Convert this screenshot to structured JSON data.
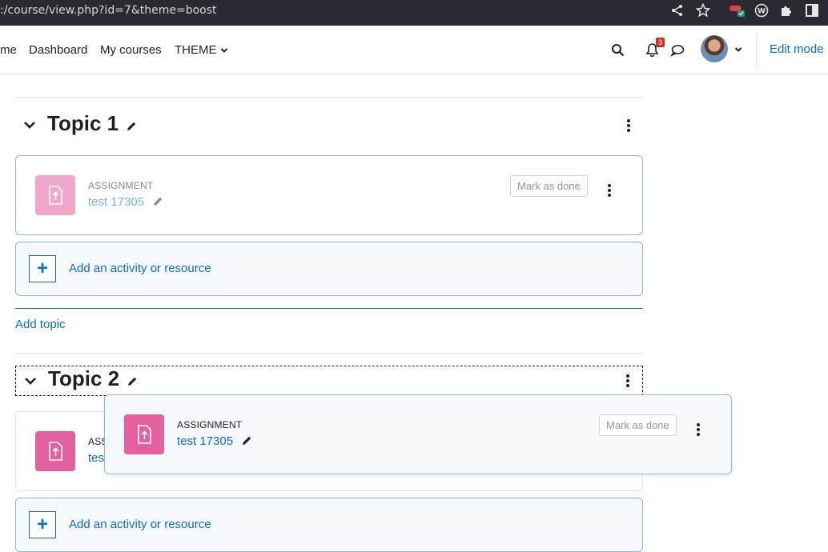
{
  "browser": {
    "url": ":/course/view.php?id=7&theme=boost",
    "icons": [
      "share-icon",
      "star-icon",
      "extension-red-icon",
      "wordpress-icon",
      "puzzle-icon",
      "sidebar-icon"
    ]
  },
  "navbar": {
    "home_partial": "me",
    "dashboard": "Dashboard",
    "my_courses": "My courses",
    "theme": "THEME",
    "notification_count": "3",
    "edit_mode": "Edit mode"
  },
  "sections": [
    {
      "title": "Topic 1",
      "activity": {
        "type": "ASSIGNMENT",
        "name": "test 17305",
        "mark_done": "Mark as done"
      },
      "add_activity": "Add an activity or resource"
    },
    {
      "title": "Topic 2",
      "activity": {
        "type_partial": "ASS",
        "name_partial": "tes"
      },
      "add_activity": "Add an activity or resource"
    }
  ],
  "add_topic": "Add topic",
  "dragged_activity": {
    "type": "ASSIGNMENT",
    "name": "test 17305",
    "mark_done": "Mark as done"
  },
  "colors": {
    "accent": "#0f6cbf",
    "assignment_icon": "#e5609f",
    "badge": "#ca3120"
  }
}
